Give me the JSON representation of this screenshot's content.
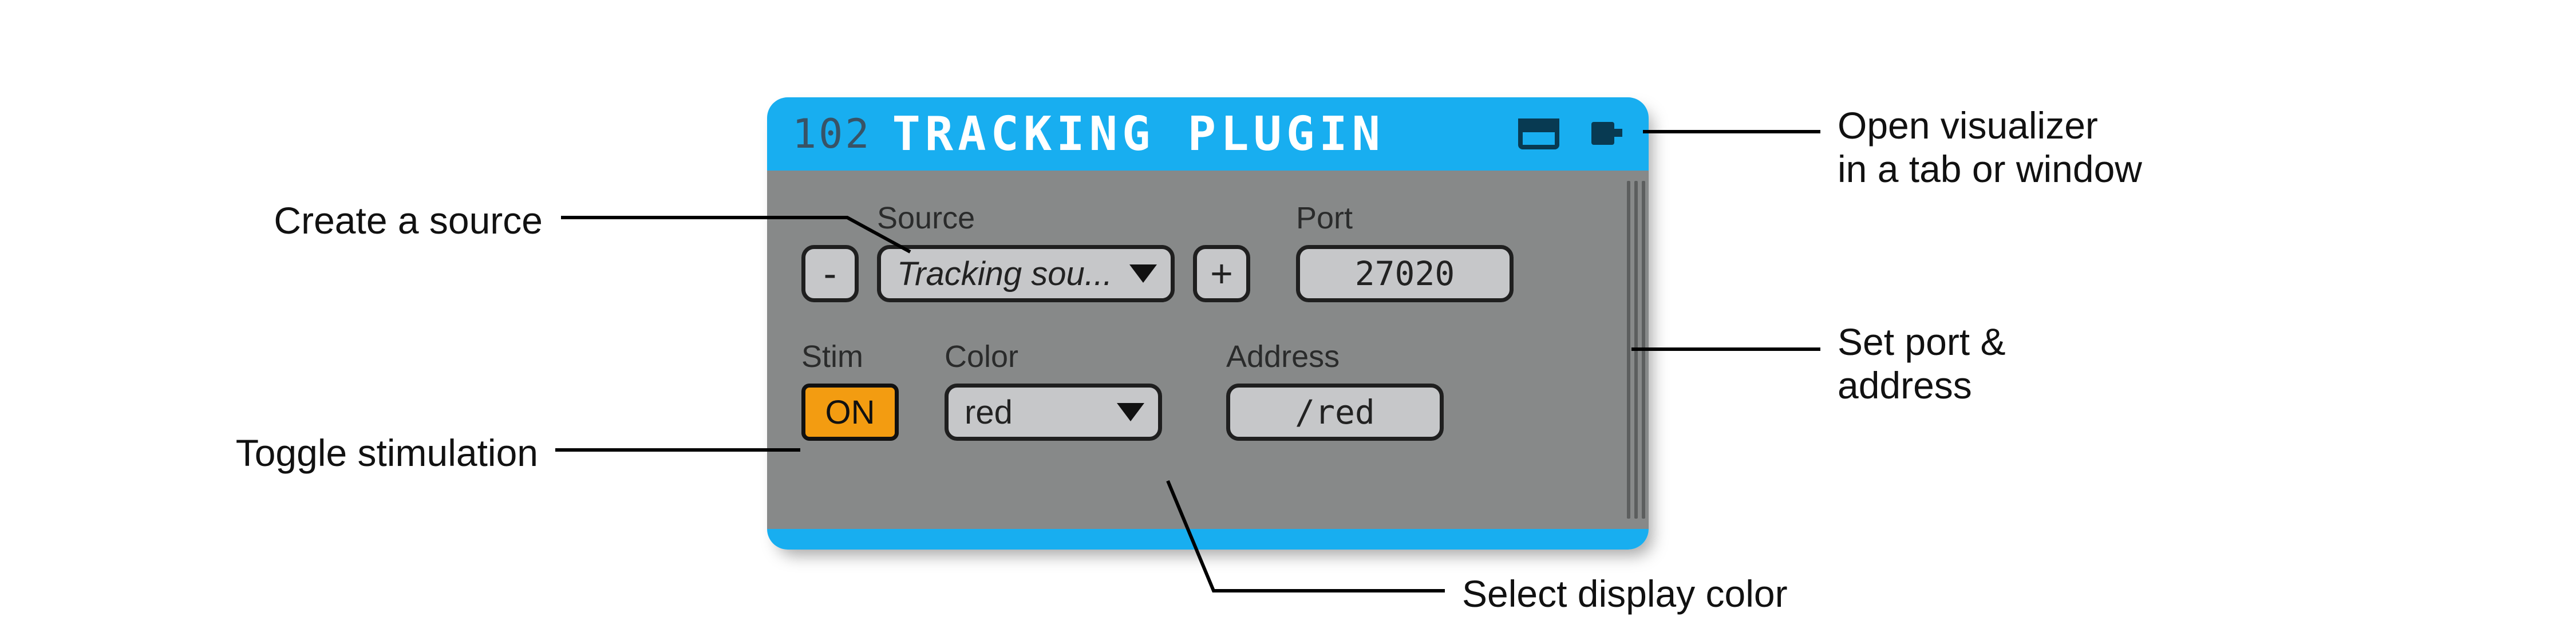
{
  "header": {
    "id": "102",
    "title": "TRACKING PLUGIN"
  },
  "labels": {
    "source": "Source",
    "port": "Port",
    "stim": "Stim",
    "color": "Color",
    "address": "Address"
  },
  "controls": {
    "remove": "-",
    "add": "+",
    "source_selected": "Tracking sou...",
    "port_value": "27020",
    "stim_state": "ON",
    "color_selected": "red",
    "address_value": "/red"
  },
  "callouts": {
    "create_source": "Create a source",
    "toggle_stim": "Toggle stimulation",
    "open_vis_1": "Open visualizer",
    "open_vis_2": "in a tab or window",
    "set_port_1": "Set port &",
    "set_port_2": "address",
    "select_color": "Select display color"
  }
}
